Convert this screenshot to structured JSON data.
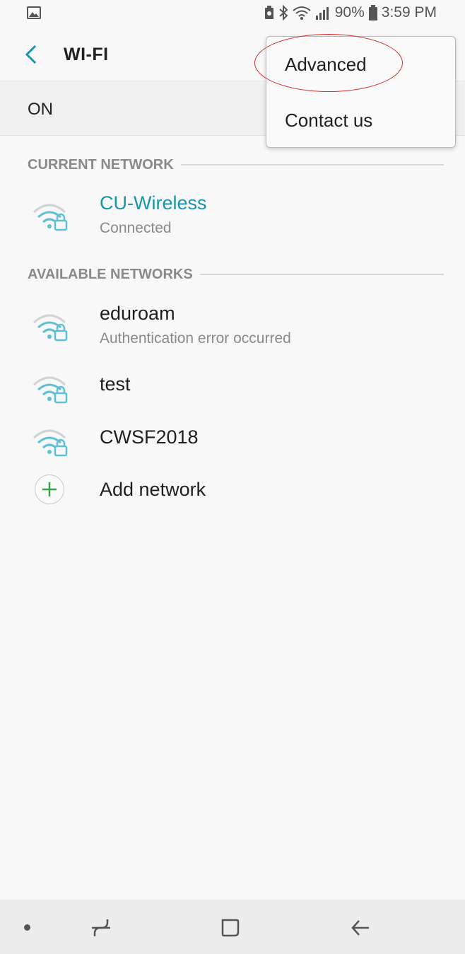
{
  "status": {
    "battery_percent": "90%",
    "time": "3:59 PM",
    "icons": [
      "gallery-icon",
      "battery-saver-icon",
      "bluetooth-icon",
      "wifi-icon",
      "signal-icon",
      "battery-icon"
    ]
  },
  "appbar": {
    "title": "WI-FI"
  },
  "switch": {
    "label": "ON"
  },
  "current_section": "CURRENT NETWORK",
  "current_network": {
    "name": "CU-Wireless",
    "status": "Connected"
  },
  "available_section": "AVAILABLE NETWORKS",
  "networks": [
    {
      "name": "eduroam",
      "status": "Authentication error occurred"
    },
    {
      "name": "test",
      "status": ""
    },
    {
      "name": "CWSF2018",
      "status": ""
    }
  ],
  "add_network": "Add network",
  "menu": {
    "items": [
      "Advanced",
      "Contact us"
    ]
  },
  "colors": {
    "accent": "#1795ad",
    "add": "#3aa34a",
    "annotation": "#d0312d"
  }
}
